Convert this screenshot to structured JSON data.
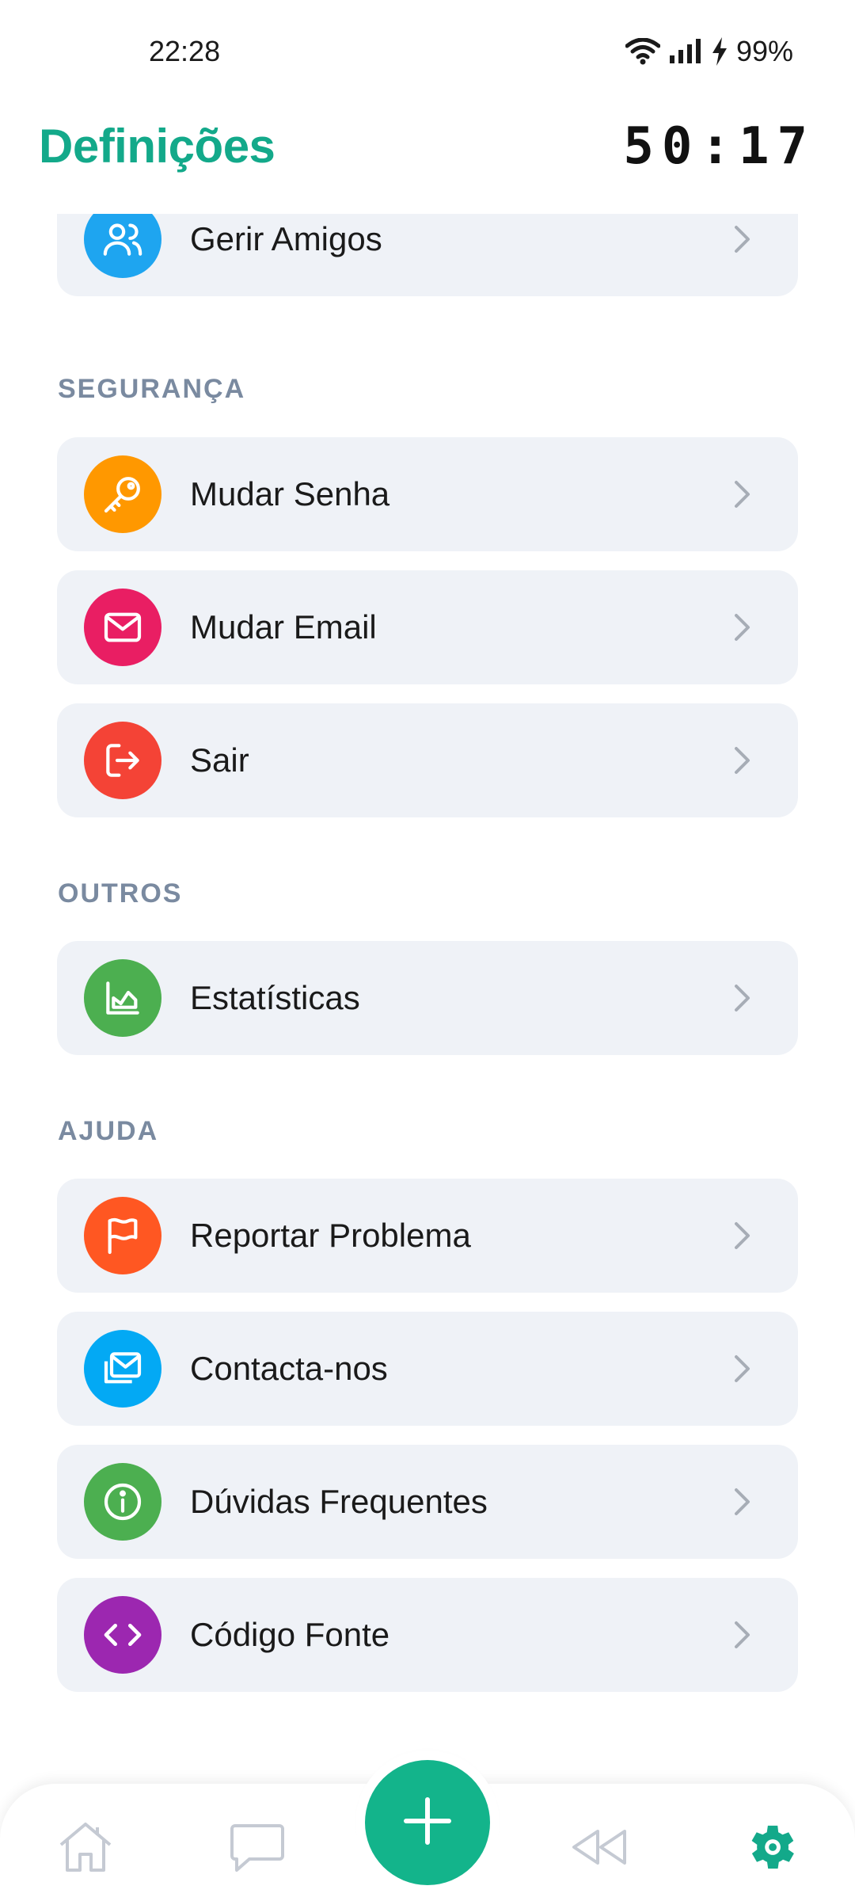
{
  "status_bar": {
    "time": "22:28",
    "battery": "99%",
    "icons": [
      "wifi-icon",
      "signal-icon",
      "charging-bolt-icon"
    ]
  },
  "header": {
    "title": "Definições",
    "timer": "50:17"
  },
  "colors": {
    "accent": "#13a98a",
    "fab": "#13b48b",
    "row_bg": "#eff2f7",
    "section_label": "#7a8aa0"
  },
  "rows_top": [
    {
      "label": "Gerir Amigos",
      "icon": "users-icon",
      "color": "#1ea5f0"
    }
  ],
  "sections": {
    "seguranca": "SEGURANÇA",
    "outros": "OUTROS",
    "ajuda": "AJUDA"
  },
  "seguranca_items": [
    {
      "label": "Mudar Senha",
      "icon": "key-icon",
      "color": "#ff9800"
    },
    {
      "label": "Mudar Email",
      "icon": "mail-icon",
      "color": "#e91e63"
    },
    {
      "label": "Sair",
      "icon": "logout-icon",
      "color": "#f44336"
    }
  ],
  "outros_items": [
    {
      "label": "Estatísticas",
      "icon": "chart-icon",
      "color": "#4caf50"
    }
  ],
  "ajuda_items": [
    {
      "label": "Reportar Problema",
      "icon": "flag-icon",
      "color": "#ff5722"
    },
    {
      "label": "Contacta-nos",
      "icon": "mail-stack-icon",
      "color": "#03a9f4"
    },
    {
      "label": "Dúvidas Frequentes",
      "icon": "info-icon",
      "color": "#4caf50"
    },
    {
      "label": "Código Fonte",
      "icon": "code-icon",
      "color": "#9c27b0"
    }
  ],
  "bottom_nav": {
    "items": [
      "home-icon",
      "chat-icon",
      "add-icon",
      "rewind-icon",
      "settings-icon"
    ],
    "active": "settings-icon"
  }
}
